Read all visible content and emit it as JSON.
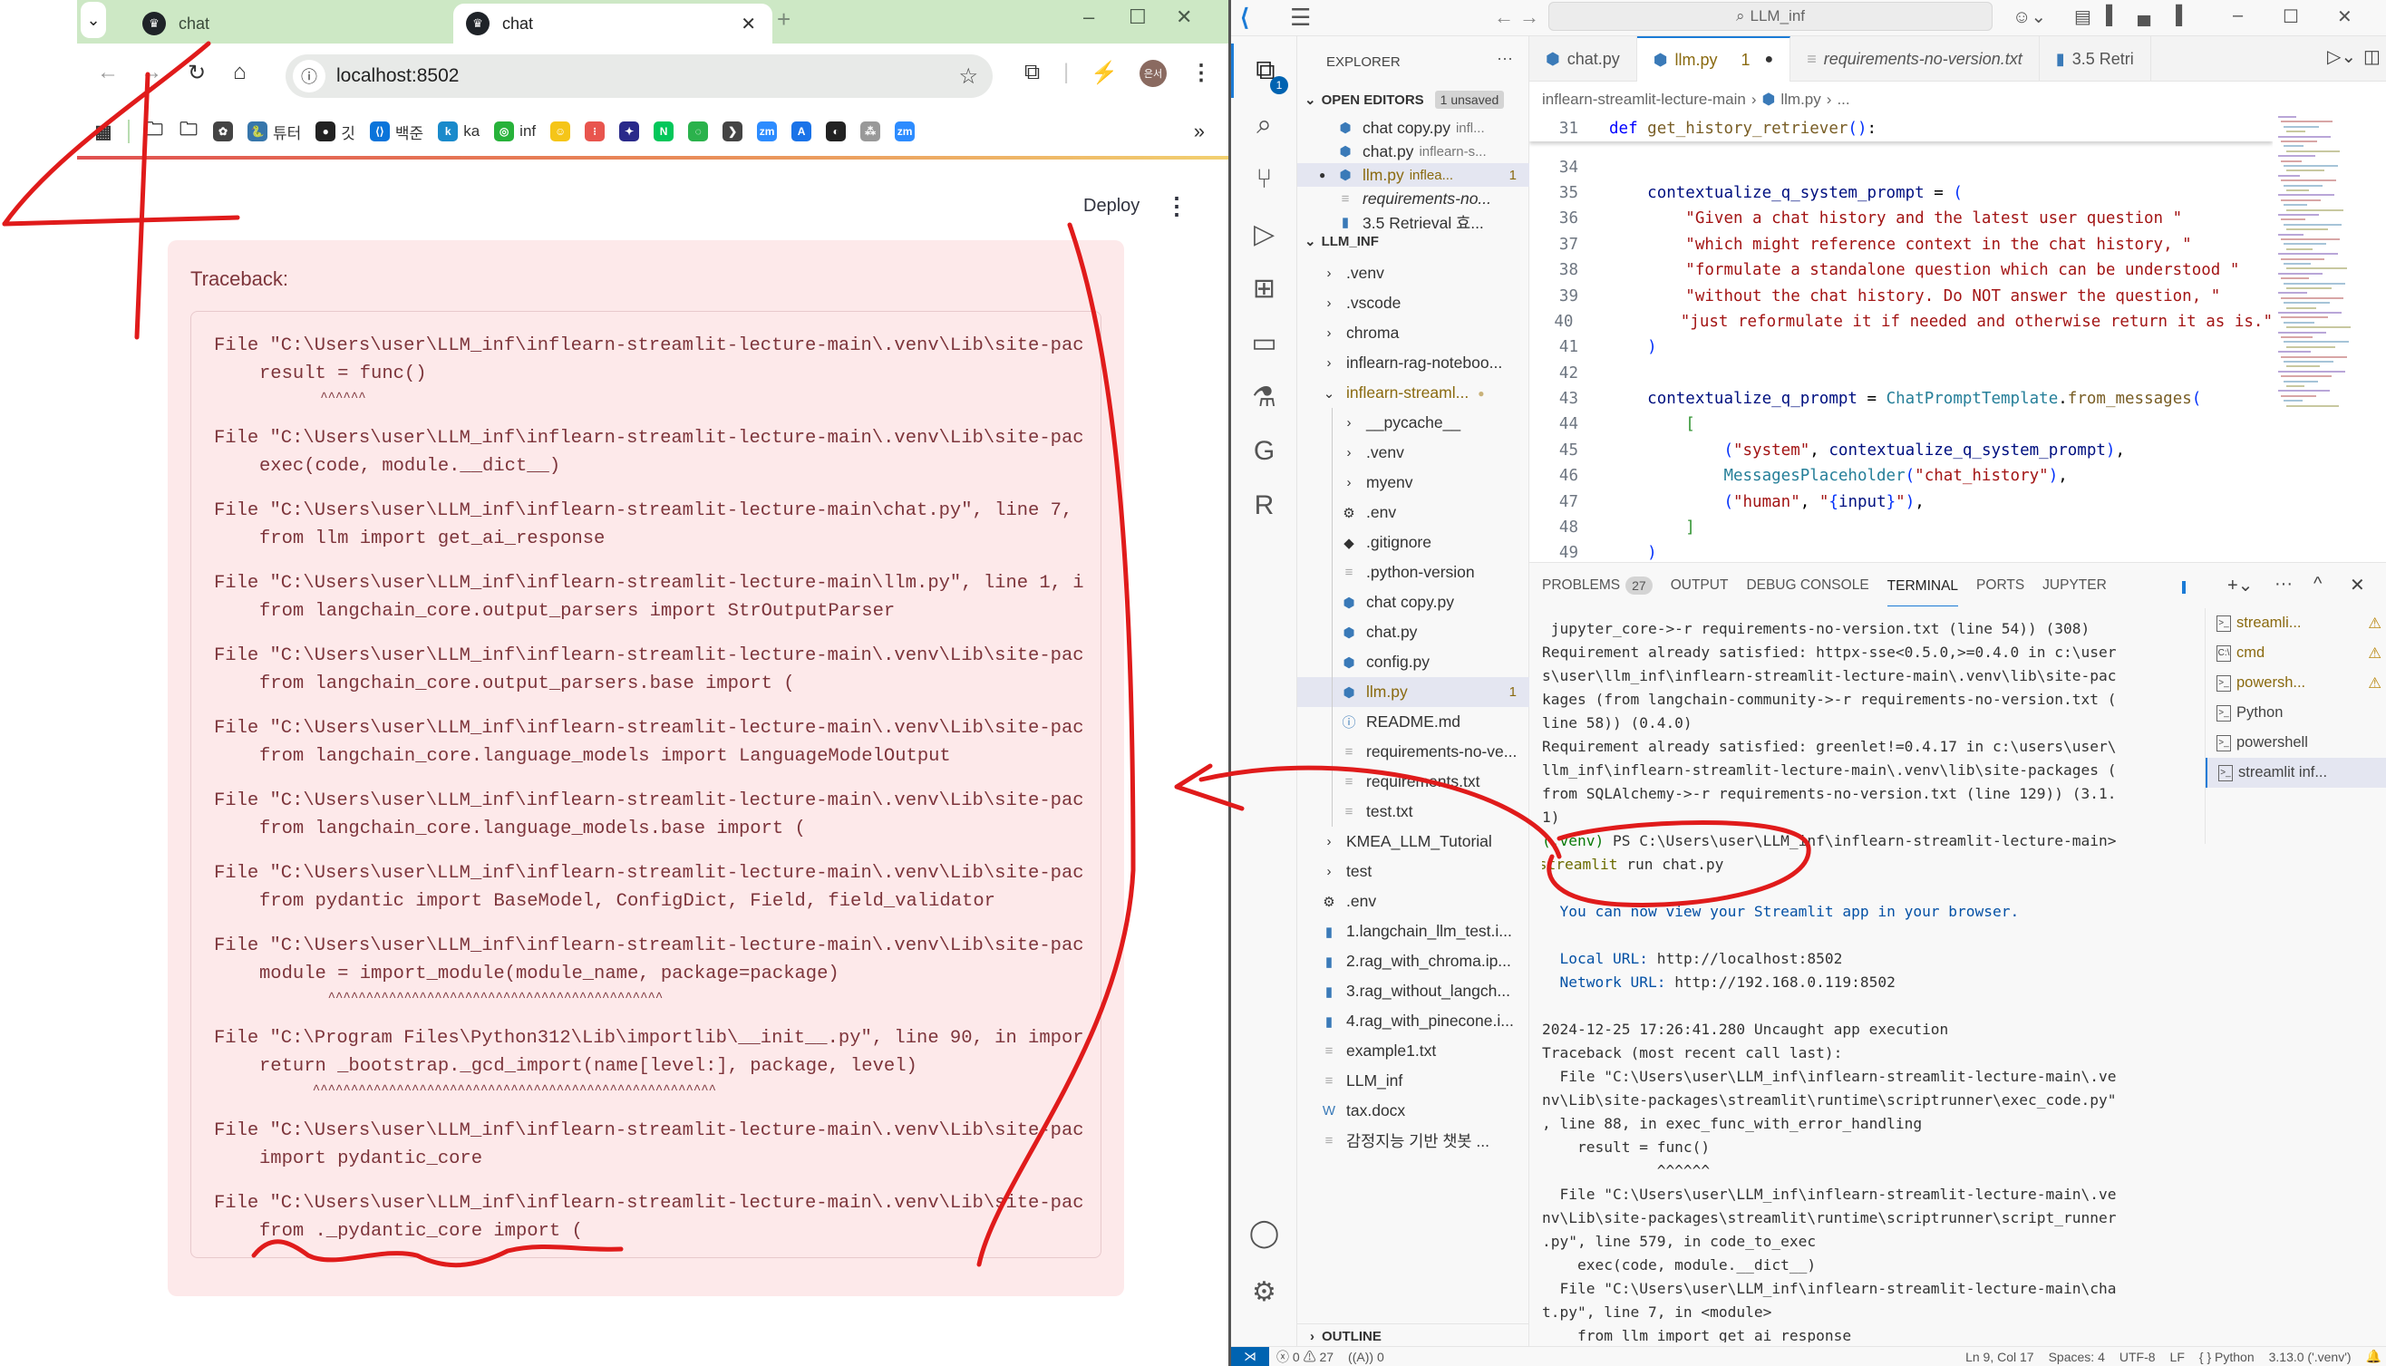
{
  "browser": {
    "tabs": [
      {
        "label": "chat",
        "active": false
      },
      {
        "label": "chat",
        "active": true
      }
    ],
    "address": "localhost:8502",
    "profile_initials": "은서",
    "bookmarks": [
      {
        "icon": "apps-grid-icon",
        "label": ""
      },
      {
        "icon": "folder-icon",
        "label": ""
      },
      {
        "icon": "folder-icon",
        "label": ""
      },
      {
        "icon": "openai-icon",
        "label": ""
      },
      {
        "icon": "python-icon",
        "label": "튜터"
      },
      {
        "icon": "github-icon",
        "label": "깃"
      },
      {
        "icon": "code-brackets-icon",
        "label": "백준"
      },
      {
        "icon": "k-icon",
        "label": "ka"
      },
      {
        "icon": "inflearn-icon",
        "label": "inf"
      },
      {
        "icon": "huggingface-icon",
        "label": ""
      },
      {
        "icon": "red-dots-icon",
        "label": ""
      },
      {
        "icon": "anime-icon",
        "label": ""
      },
      {
        "icon": "naver-icon",
        "label": "N"
      },
      {
        "icon": "green-leaf-icon",
        "label": ""
      },
      {
        "icon": "arrow-tag-icon",
        "label": ""
      },
      {
        "icon": "zoom-icon",
        "label": "zm"
      },
      {
        "icon": "a-icon",
        "label": "A"
      },
      {
        "icon": "globe-icon",
        "label": ""
      },
      {
        "icon": "korean-tag-icon",
        "label": ""
      },
      {
        "icon": "zoom-icon",
        "label": "zm"
      }
    ],
    "more_bookmarks": "»"
  },
  "streamlit": {
    "deploy_label": "Deploy",
    "traceback_label": "Traceback:",
    "traceback": [
      {
        "file": "File \"C:\\Users\\user\\LLM_inf\\inflearn-streamlit-lecture-main\\.venv\\Lib\\site-pac",
        "code": "result = func()",
        "caret": "        ^^^^^^"
      },
      {
        "file": "File \"C:\\Users\\user\\LLM_inf\\inflearn-streamlit-lecture-main\\.venv\\Lib\\site-pac",
        "code": "exec(code, module.__dict__)",
        "caret": ""
      },
      {
        "file": "File \"C:\\Users\\user\\LLM_inf\\inflearn-streamlit-lecture-main\\chat.py\", line 7,",
        "code": "from llm import get_ai_response",
        "caret": ""
      },
      {
        "file": "File \"C:\\Users\\user\\LLM_inf\\inflearn-streamlit-lecture-main\\llm.py\", line 1, i",
        "code": "from langchain_core.output_parsers import StrOutputParser",
        "caret": ""
      },
      {
        "file": "File \"C:\\Users\\user\\LLM_inf\\inflearn-streamlit-lecture-main\\.venv\\Lib\\site-pac",
        "code": "from langchain_core.output_parsers.base import (",
        "caret": ""
      },
      {
        "file": "File \"C:\\Users\\user\\LLM_inf\\inflearn-streamlit-lecture-main\\.venv\\Lib\\site-pac",
        "code": "from langchain_core.language_models import LanguageModelOutput",
        "caret": ""
      },
      {
        "file": "File \"C:\\Users\\user\\LLM_inf\\inflearn-streamlit-lecture-main\\.venv\\Lib\\site-pac",
        "code": "from langchain_core.language_models.base import (",
        "caret": ""
      },
      {
        "file": "File \"C:\\Users\\user\\LLM_inf\\inflearn-streamlit-lecture-main\\.venv\\Lib\\site-pac",
        "code": "from pydantic import BaseModel, ConfigDict, Field, field_validator",
        "caret": ""
      },
      {
        "file": "File \"C:\\Users\\user\\LLM_inf\\inflearn-streamlit-lecture-main\\.venv\\Lib\\site-pac",
        "code": "module = import_module(module_name, package=package)",
        "caret": "         ^^^^^^^^^^^^^^^^^^^^^^^^^^^^^^^^^^^^^^^^^^^^"
      },
      {
        "file": "File \"C:\\Program Files\\Python312\\Lib\\importlib\\__init__.py\", line 90, in impor",
        "code": "return _bootstrap._gcd_import(name[level:], package, level)",
        "caret": "       ^^^^^^^^^^^^^^^^^^^^^^^^^^^^^^^^^^^^^^^^^^^^^^^^^^^^^"
      },
      {
        "file": "File \"C:\\Users\\user\\LLM_inf\\inflearn-streamlit-lecture-main\\.venv\\Lib\\site-pac",
        "code": "import pydantic_core",
        "caret": ""
      },
      {
        "file": "File \"C:\\Users\\user\\LLM_inf\\inflearn-streamlit-lecture-main\\.venv\\Lib\\site-pac",
        "code": "from ._pydantic_core import (",
        "caret": ""
      }
    ]
  },
  "vscode": {
    "command_center": "LLM_inf",
    "explorer_title": "EXPLORER",
    "open_editors_label": "OPEN EDITORS",
    "unsaved_badge": "1 unsaved",
    "explorer_badge": "1",
    "open_editors": [
      {
        "name": "chat copy.py",
        "desc": "infl...",
        "icon": "python",
        "dirty": false,
        "problems": ""
      },
      {
        "name": "chat.py",
        "desc": "inflearn-s...",
        "icon": "python",
        "dirty": false,
        "problems": ""
      },
      {
        "name": "llm.py",
        "desc": "inflea...",
        "icon": "python",
        "dirty": true,
        "problems": "1"
      },
      {
        "name": "requirements-no...",
        "desc": "",
        "icon": "text",
        "dirty": false,
        "problems": "",
        "italic": true
      },
      {
        "name": "3.5 Retrieval 효...",
        "desc": "",
        "icon": "notebook",
        "dirty": false,
        "problems": ""
      }
    ],
    "workspace_label": "LLM_INF",
    "tree": [
      {
        "name": ".venv",
        "type": "folder",
        "depth": 1
      },
      {
        "name": ".vscode",
        "type": "folder",
        "depth": 1
      },
      {
        "name": "chroma",
        "type": "folder",
        "depth": 1
      },
      {
        "name": "inflearn-rag-noteboo...",
        "type": "folder",
        "depth": 1
      },
      {
        "name": "inflearn-streaml...",
        "type": "folder-open",
        "depth": 1,
        "modified": true
      },
      {
        "name": "__pycache__",
        "type": "folder",
        "depth": 2
      },
      {
        "name": ".venv",
        "type": "folder",
        "depth": 2
      },
      {
        "name": "myenv",
        "type": "folder",
        "depth": 2
      },
      {
        "name": ".env",
        "type": "gear",
        "depth": 2
      },
      {
        "name": ".gitignore",
        "type": "git",
        "depth": 2
      },
      {
        "name": ".python-version",
        "type": "text",
        "depth": 2
      },
      {
        "name": "chat copy.py",
        "type": "python",
        "depth": 2
      },
      {
        "name": "chat.py",
        "type": "python",
        "depth": 2
      },
      {
        "name": "config.py",
        "type": "python",
        "depth": 2
      },
      {
        "name": "llm.py",
        "type": "python",
        "depth": 2,
        "modified": true,
        "problems": "1",
        "selected": true
      },
      {
        "name": "README.md",
        "type": "info",
        "depth": 2
      },
      {
        "name": "requirements-no-ve...",
        "type": "text",
        "depth": 2
      },
      {
        "name": "requirements.txt",
        "type": "text",
        "depth": 2
      },
      {
        "name": "test.txt",
        "type": "text",
        "depth": 2
      },
      {
        "name": "KMEA_LLM_Tutorial",
        "type": "folder",
        "depth": 1
      },
      {
        "name": "test",
        "type": "folder",
        "depth": 1
      },
      {
        "name": ".env",
        "type": "gear",
        "depth": 1
      },
      {
        "name": "1.langchain_llm_test.i...",
        "type": "notebook",
        "depth": 1
      },
      {
        "name": "2.rag_with_chroma.ip...",
        "type": "notebook",
        "depth": 1
      },
      {
        "name": "3.rag_without_langch...",
        "type": "notebook",
        "depth": 1
      },
      {
        "name": "4.rag_with_pinecone.i...",
        "type": "notebook",
        "depth": 1
      },
      {
        "name": "example1.txt",
        "type": "text",
        "depth": 1
      },
      {
        "name": "LLM_inf",
        "type": "text",
        "depth": 1
      },
      {
        "name": "tax.docx",
        "type": "word",
        "depth": 1
      },
      {
        "name": "감정지능 기반 챗봇 ...",
        "type": "text",
        "depth": 1
      }
    ],
    "outline_label": "OUTLINE",
    "editor_tabs": [
      {
        "label": "chat.py",
        "icon": "python",
        "active": false
      },
      {
        "label": "llm.py",
        "icon": "python",
        "active": true,
        "problems": "1",
        "dirty": true
      },
      {
        "label": "requirements-no-version.txt",
        "icon": "text",
        "active": false,
        "italic": true
      },
      {
        "label": "3.5 Retri",
        "icon": "notebook",
        "active": false
      }
    ],
    "breadcrumbs": [
      "inflearn-streamlit-lecture-main",
      "llm.py",
      "..."
    ],
    "code": {
      "sticky": {
        "num": "31",
        "text": "def get_history_retriever():"
      },
      "lines": [
        {
          "num": "34",
          "text": ""
        },
        {
          "num": "35",
          "text": "    contextualize_q_system_prompt = ("
        },
        {
          "num": "36",
          "text": "        \"Given a chat history and the latest user question \""
        },
        {
          "num": "37",
          "text": "        \"which might reference context in the chat history, \""
        },
        {
          "num": "38",
          "text": "        \"formulate a standalone question which can be understood \""
        },
        {
          "num": "39",
          "text": "        \"without the chat history. Do NOT answer the question, \""
        },
        {
          "num": "40",
          "text": "        \"just reformulate it if needed and otherwise return it as is.\""
        },
        {
          "num": "41",
          "text": "    )"
        },
        {
          "num": "42",
          "text": ""
        },
        {
          "num": "43",
          "text": "    contextualize_q_prompt = ChatPromptTemplate.from_messages("
        },
        {
          "num": "44",
          "text": "        ["
        },
        {
          "num": "45",
          "text": "            (\"system\", contextualize_q_system_prompt),"
        },
        {
          "num": "46",
          "text": "            MessagesPlaceholder(\"chat_history\"),"
        },
        {
          "num": "47",
          "text": "            (\"human\", \"{input}\"),"
        },
        {
          "num": "48",
          "text": "        ]"
        },
        {
          "num": "49",
          "text": "    )"
        }
      ]
    },
    "panel_tabs": [
      {
        "label": "PROBLEMS",
        "badge": "27"
      },
      {
        "label": "OUTPUT"
      },
      {
        "label": "DEBUG CONSOLE"
      },
      {
        "label": "TERMINAL",
        "active": true
      },
      {
        "label": "PORTS"
      },
      {
        "label": "JUPYTER"
      }
    ],
    "terminal_lines": [
      {
        "text": " jupyter_core->-r requirements-no-version.txt (line 54)) (308)",
        "color": ""
      },
      {
        "text": "Requirement already satisfied: httpx-sse<0.5.0,>=0.4.0 in c:\\user",
        "color": ""
      },
      {
        "text": "s\\user\\llm_inf\\inflearn-streamlit-lecture-main\\.venv\\lib\\site-pac",
        "color": ""
      },
      {
        "text": "kages (from langchain-community->-r requirements-no-version.txt (",
        "color": ""
      },
      {
        "text": "line 58)) (0.4.0)",
        "color": ""
      },
      {
        "text": "Requirement already satisfied: greenlet!=0.4.17 in c:\\users\\user\\",
        "color": ""
      },
      {
        "text": "llm_inf\\inflearn-streamlit-lecture-main\\.venv\\lib\\site-packages (",
        "color": ""
      },
      {
        "text": "from SQLAlchemy->-r requirements-no-version.txt (line 129)) (3.1.",
        "color": ""
      },
      {
        "text": "1)",
        "color": ""
      },
      {
        "text": "(.venv) PS C:\\Users\\user\\LLM_inf\\inflearn-streamlit-lecture-main>",
        "color": "prompt"
      },
      {
        "text": " streamlit run chat.py",
        "color": "command"
      },
      {
        "text": "",
        "color": ""
      },
      {
        "text": "  You can now view your Streamlit app in your browser.",
        "color": "blue"
      },
      {
        "text": "",
        "color": ""
      },
      {
        "text": "  Local URL: http://localhost:8502",
        "color": "url"
      },
      {
        "text": "  Network URL: http://192.168.0.119:8502",
        "color": "url"
      },
      {
        "text": "",
        "color": ""
      },
      {
        "text": "2024-12-25 17:26:41.280 Uncaught app execution",
        "color": ""
      },
      {
        "text": "Traceback (most recent call last):",
        "color": ""
      },
      {
        "text": "  File \"C:\\Users\\user\\LLM_inf\\inflearn-streamlit-lecture-main\\.ve",
        "color": ""
      },
      {
        "text": "nv\\Lib\\site-packages\\streamlit\\runtime\\scriptrunner\\exec_code.py\"",
        "color": ""
      },
      {
        "text": ", line 88, in exec_func_with_error_handling",
        "color": ""
      },
      {
        "text": "    result = func()",
        "color": ""
      },
      {
        "text": "             ^^^^^^",
        "color": ""
      },
      {
        "text": "  File \"C:\\Users\\user\\LLM_inf\\inflearn-streamlit-lecture-main\\.ve",
        "color": ""
      },
      {
        "text": "nv\\Lib\\site-packages\\streamlit\\runtime\\scriptrunner\\script_runner",
        "color": ""
      },
      {
        "text": ".py\", line 579, in code_to_exec",
        "color": ""
      },
      {
        "text": "    exec(code, module.__dict__)",
        "color": ""
      },
      {
        "text": "  File \"C:\\Users\\user\\LLM_inf\\inflearn-streamlit-lecture-main\\cha",
        "color": ""
      },
      {
        "text": "t.py\", line 7, in <module>",
        "color": ""
      },
      {
        "text": "    from llm import get_ai_response",
        "color": ""
      }
    ],
    "terminals": [
      {
        "label": "streamli...",
        "icon": "powershell",
        "warn": true,
        "modified": true
      },
      {
        "label": "cmd",
        "icon": "cmd",
        "warn": true,
        "modified": true
      },
      {
        "label": "powersh...",
        "icon": "powershell",
        "warn": true,
        "modified": true
      },
      {
        "label": "Python",
        "icon": "powershell",
        "warn": false
      },
      {
        "label": "powershell",
        "icon": "powershell",
        "warn": false
      },
      {
        "label": "streamlit inf...",
        "icon": "powershell",
        "warn": false,
        "selected": true
      }
    ],
    "status": {
      "errors": "0",
      "warnings": "27",
      "ports": "0",
      "position": "Ln 9, Col 17",
      "spaces": "Spaces: 4",
      "encoding": "UTF-8",
      "eol": "LF",
      "language": "Python",
      "interpreter": "3.13.0 ('.venv')"
    }
  },
  "annotation_color": "#e01b1b"
}
